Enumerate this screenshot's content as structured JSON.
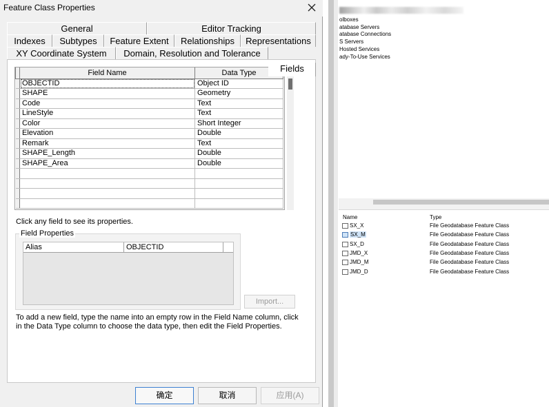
{
  "dialog": {
    "title": "Feature Class Properties",
    "tabs_row1": [
      "General",
      "Editor Tracking"
    ],
    "tabs_row2": [
      "Indexes",
      "Subtypes",
      "Feature Extent",
      "Relationships",
      "Representations"
    ],
    "tabs_row3": [
      "XY Coordinate System",
      "Domain, Resolution and Tolerance",
      "Fields"
    ],
    "active_tab": "Fields",
    "grid": {
      "columns": [
        "Field Name",
        "Data Type"
      ],
      "rows": [
        {
          "name": "OBJECTID",
          "type": "Object ID"
        },
        {
          "name": "SHAPE",
          "type": "Geometry"
        },
        {
          "name": "Code",
          "type": "Text"
        },
        {
          "name": "LineStyle",
          "type": "Text"
        },
        {
          "name": "Color",
          "type": "Short Integer"
        },
        {
          "name": "Elevation",
          "type": "Double"
        },
        {
          "name": "Remark",
          "type": "Text"
        },
        {
          "name": "SHAPE_Length",
          "type": "Double"
        },
        {
          "name": "SHAPE_Area",
          "type": "Double"
        },
        {
          "name": "",
          "type": ""
        },
        {
          "name": "",
          "type": ""
        },
        {
          "name": "",
          "type": ""
        },
        {
          "name": "",
          "type": ""
        }
      ]
    },
    "hint": "Click any field to see its properties.",
    "field_properties": {
      "legend": "Field Properties",
      "label": "Alias",
      "value": "OBJECTID"
    },
    "import_label": "Import...",
    "help_text": "To add a new field, type the name into an empty row in the Field Name column, click in the Data Type column to choose the data type, then edit the Field Properties.",
    "buttons": {
      "ok": "确定",
      "cancel": "取消",
      "apply": "应用(A)"
    }
  },
  "tree": {
    "items": [
      "olboxes",
      "atabase Servers",
      "atabase Connections",
      "S Servers",
      "Hosted Services",
      "ady-To-Use Services"
    ]
  },
  "catalog": {
    "columns": [
      "Name",
      "Type"
    ],
    "rows": [
      {
        "name": "SX_X",
        "type": "File Geodatabase Feature Class",
        "selected": false
      },
      {
        "name": "SX_M",
        "type": "File Geodatabase Feature Class",
        "selected": true
      },
      {
        "name": "SX_D",
        "type": "File Geodatabase Feature Class",
        "selected": false
      },
      {
        "name": "JMD_X",
        "type": "File Geodatabase Feature Class",
        "selected": false
      },
      {
        "name": "JMD_M",
        "type": "File Geodatabase Feature Class",
        "selected": false
      },
      {
        "name": "JMD_D",
        "type": "File Geodatabase Feature Class",
        "selected": false
      }
    ]
  }
}
